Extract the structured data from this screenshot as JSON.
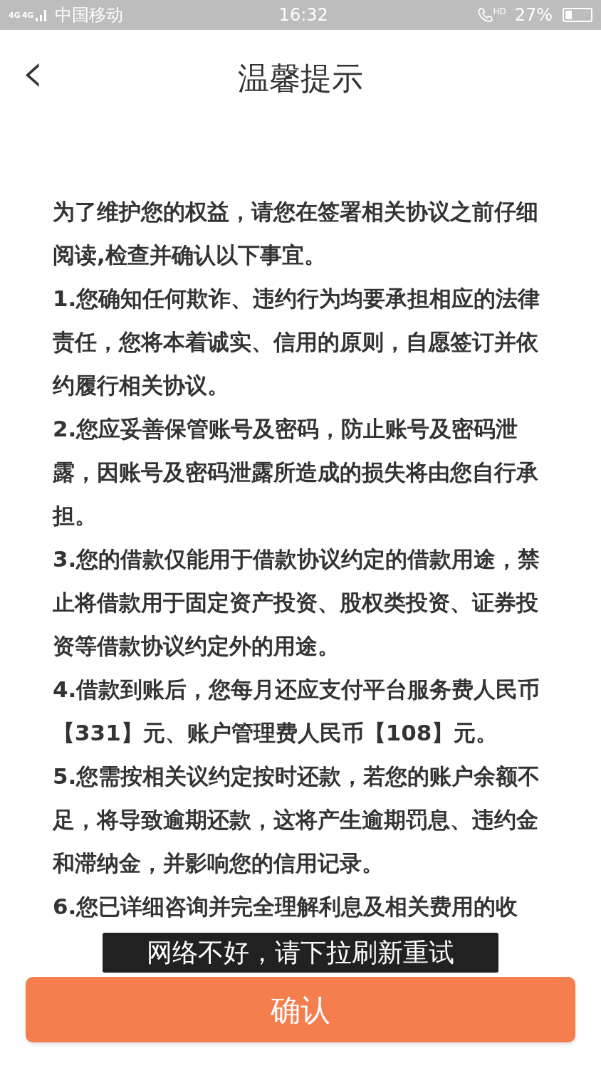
{
  "status_bar": {
    "network": [
      "4G",
      "4G"
    ],
    "carrier": "中国移动",
    "time": "16:32",
    "call_label": "HD",
    "battery": "27%",
    "battery_indicator": {
      "level": 0.27
    }
  },
  "header": {
    "back": "‹",
    "title": "温馨提示"
  },
  "paragraphs": [
    "为了维护您的权益，请您在签署相关协议之前仔细阅读,检查并确认以下事宜。",
    "1.您确知任何欺诈、违约行为均要承担相应的法律责任，您将本着诚实、信用的原则，自愿签订并依约履行相关协议。",
    "2.您应妥善保管账号及密码，防止账号及密码泄露，因账号及密码泄露所造成的损失将由您自行承担。",
    "3.您的借款仅能用于借款协议约定的借款用途，禁止将借款用于固定资产投资、股权类投资、证券投资等借款协议约定外的用途。",
    "4.借款到账后，您每月还应支付平台服务费人民币【331】元、账户管理费人民币【108】元。",
    "5.您需按相关议约定按时还款，若您的账户余额不足，将导致逾期还款，这将产生逾期罚息、违约金和滞纳金，并影响您的信用记录。",
    "6.您已详细咨询并完全理解利息及相关费用的收"
  ],
  "toast": "网络不好，请下拉刷新重试",
  "confirm_button": "确认"
}
